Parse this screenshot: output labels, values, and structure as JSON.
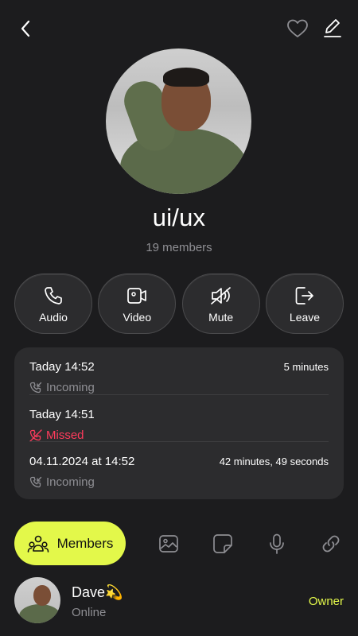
{
  "header": {
    "back_icon": "chevron-left-icon",
    "favorite_icon": "heart-icon",
    "edit_icon": "pencil-icon"
  },
  "group": {
    "name": "ui/ux",
    "members_count": "19 members"
  },
  "actions": [
    {
      "label": "Audio",
      "icon": "phone-icon"
    },
    {
      "label": "Video",
      "icon": "video-icon"
    },
    {
      "label": "Mute",
      "icon": "speaker-muted-icon"
    },
    {
      "label": "Leave",
      "icon": "exit-icon"
    }
  ],
  "calls": [
    {
      "when": "Taday 14:52",
      "duration": "5 minutes",
      "type": "Incoming"
    },
    {
      "when": "Taday 14:51",
      "duration": "",
      "type": "Missed"
    },
    {
      "when": "04.11.2024 at 14:52",
      "duration": "42 minutes, 49 seconds",
      "type": "Incoming"
    }
  ],
  "tabs": {
    "members_label": "Members",
    "accent_color": "#e3f84a"
  },
  "members": [
    {
      "name": "Dave💫",
      "status": "Online",
      "role": "Owner"
    }
  ],
  "colors": {
    "background": "#1c1c1e",
    "card": "#2c2c2e",
    "accent": "#e3f84a",
    "missed": "#ff3b5c",
    "muted_text": "#8e8e93"
  }
}
